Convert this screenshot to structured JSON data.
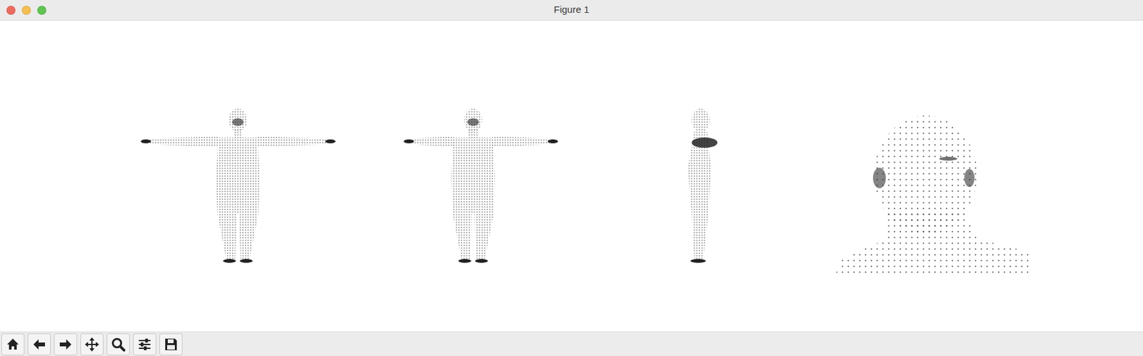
{
  "window": {
    "title": "Figure 1",
    "controls": [
      {
        "kind": "close",
        "color": "#ed6a5e"
      },
      {
        "kind": "minimize",
        "color": "#f5bf4f"
      },
      {
        "kind": "zoom",
        "color": "#61c554"
      }
    ]
  },
  "plots": [
    {
      "kind": "front"
    },
    {
      "kind": "three-quarter"
    },
    {
      "kind": "side"
    },
    {
      "kind": "head"
    }
  ],
  "toolbar": [
    {
      "kind": "home"
    },
    {
      "kind": "back"
    },
    {
      "kind": "forward"
    },
    {
      "kind": "pan"
    },
    {
      "kind": "zoom"
    },
    {
      "kind": "configure"
    },
    {
      "kind": "save"
    }
  ]
}
